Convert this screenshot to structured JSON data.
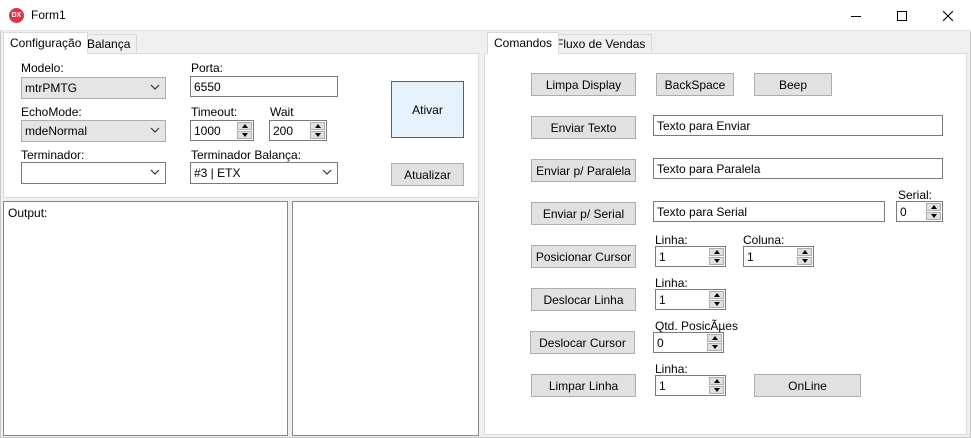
{
  "window": {
    "icon_text": "DX",
    "title": "Form1"
  },
  "left_tabs": [
    "Configuração",
    "Balança"
  ],
  "config": {
    "modelo_label": "Modelo:",
    "modelo_value": "mtrPMTG",
    "porta_label": "Porta:",
    "porta_value": "6550",
    "echomode_label": "EchoMode:",
    "echomode_value": "mdeNormal",
    "timeout_label": "Timeout:",
    "timeout_value": "1000",
    "wait_label": "Wait",
    "wait_value": "200",
    "terminador_label": "Terminador:",
    "terminador_value": "",
    "term_balanca_label": "Terminador Balança:",
    "term_balanca_value": "#3 | ETX",
    "ativar_label": "Ativar",
    "atualizar_label": "Atualizar"
  },
  "output": {
    "label": "Output:"
  },
  "right_tabs": [
    "Comandos",
    "Fluxo de Vendas"
  ],
  "commands": {
    "limpa_display": "Limpa Display",
    "backspace": "BackSpace",
    "beep": "Beep",
    "enviar_texto": "Enviar Texto",
    "enviar_texto_value": "Texto para Enviar",
    "enviar_paralela": "Enviar p/ Paralela",
    "enviar_paralela_value": "Texto para Paralela",
    "enviar_serial": "Enviar p/ Serial",
    "enviar_serial_value": "Texto para Serial",
    "serial_label": "Serial:",
    "serial_value": "0",
    "posicionar_cursor": "Posicionar Cursor",
    "pos_linha_label": "Linha:",
    "pos_linha_value": "1",
    "pos_coluna_label": "Coluna:",
    "pos_coluna_value": "1",
    "deslocar_linha": "Deslocar Linha",
    "desl_linha_label": "Linha:",
    "desl_linha_value": "1",
    "deslocar_cursor": "Deslocar Cursor",
    "qtd_label": "Qtd. PosicÃµes",
    "qtd_value": "0",
    "limpar_linha": "Limpar Linha",
    "limpar_linha_label": "Linha:",
    "limpar_linha_value": "1",
    "online": "OnLine"
  }
}
